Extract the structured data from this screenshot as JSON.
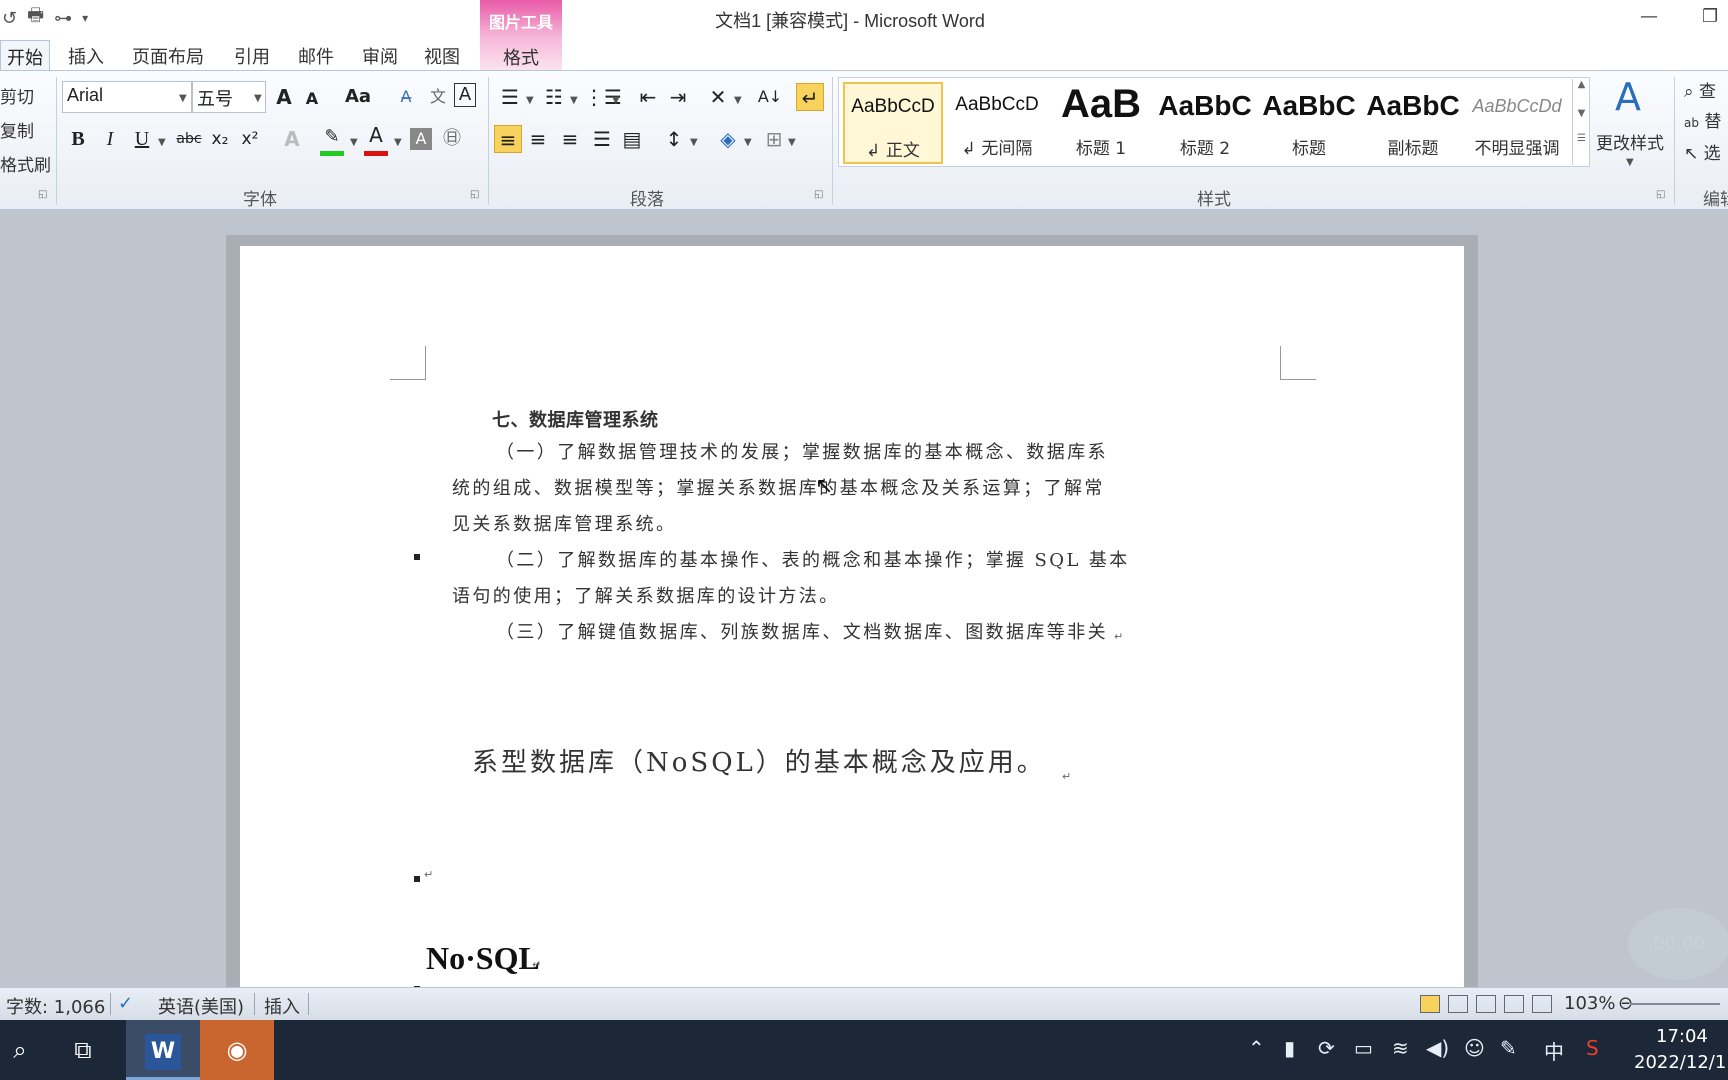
{
  "window": {
    "title": "文档1 [兼容模式] - Microsoft Word",
    "contextual_header": "图片工具"
  },
  "tabs": [
    {
      "label": "开始",
      "active": true
    },
    {
      "label": "插入"
    },
    {
      "label": "页面布局"
    },
    {
      "label": "引用"
    },
    {
      "label": "邮件"
    },
    {
      "label": "审阅"
    },
    {
      "label": "视图"
    },
    {
      "label": "格式",
      "contextual": true
    }
  ],
  "clipboard": {
    "cut": "剪切",
    "copy": "复制",
    "format_painter": "格式刷"
  },
  "font": {
    "name": "Arial",
    "size": "五号",
    "grow": "A",
    "shrink": "A",
    "case": "Aa",
    "bold": "B",
    "italic": "I",
    "underline": "U",
    "strike": "abc",
    "subscript": "x₂",
    "superscript": "x²",
    "group_label": "字体",
    "highlight_color": "#22cc22",
    "font_color": "#dd1111"
  },
  "paragraph": {
    "group_label": "段落"
  },
  "styles": {
    "group_label": "样式",
    "items": [
      {
        "preview": "AaBbCcD",
        "name": "↲ 正文",
        "selected": true
      },
      {
        "preview": "AaBbCcD",
        "name": "↲ 无间隔"
      },
      {
        "preview": "AaB",
        "name": "标题 1"
      },
      {
        "preview": "AaBbC",
        "name": "标题 2"
      },
      {
        "preview": "AaBbC",
        "name": "标题"
      },
      {
        "preview": "AaBbC",
        "name": "副标题"
      },
      {
        "preview": "AaBbCcDd",
        "name": "不明显强调"
      }
    ],
    "change_styles": "更改样式"
  },
  "editing": {
    "find": "查",
    "replace": "替",
    "select": "选",
    "group_label": "编辑"
  },
  "document": {
    "heading": "七、数据库管理系统",
    "lines": [
      "（一）了解数据管理技术的发展；掌握数据库的基本概念、数据库系",
      "统的组成、数据模型等；掌握关系数据库的基本概念及关系运算；了解常",
      "见关系数据库管理系统。",
      "（二）了解数据库的基本操作、表的概念和基本操作；掌握 SQL 基本",
      "语句的使用；了解关系数据库的设计方法。",
      "（三）了解键值数据库、列族数据库、文档数据库、图数据库等非关"
    ],
    "big_line": "系型数据库（NoSQL）的基本概念及应用。",
    "nosql_heading": "No·SQL",
    "paragraph_mark": "↵"
  },
  "overlay": {
    "timer": "00:00"
  },
  "statusbar": {
    "word_count": "字数: 1,066",
    "language": "英语(美国)",
    "mode": "插入",
    "zoom": "103%"
  },
  "taskbar": {
    "ime": "中",
    "time": "17:04",
    "date": "2022/12/1"
  }
}
